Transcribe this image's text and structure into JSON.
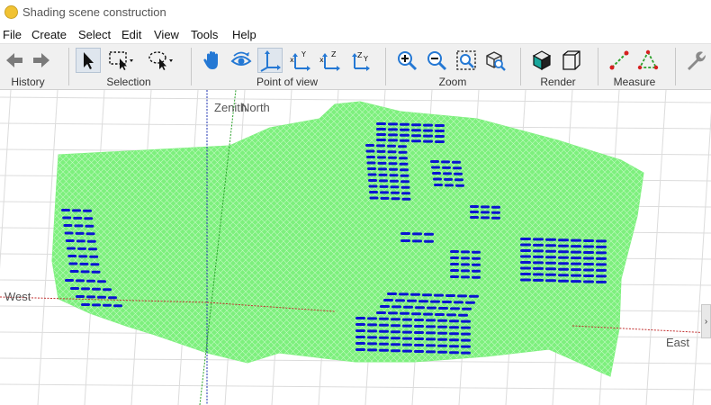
{
  "window": {
    "title": "Shading scene construction"
  },
  "menu": [
    "File",
    "Create",
    "Select",
    "Edit",
    "View",
    "Tools",
    "Help"
  ],
  "toolbar": {
    "groups": [
      "History",
      "Selection",
      "Point of view",
      "Zoom",
      "Render",
      "Measure"
    ]
  },
  "viewport": {
    "labels": {
      "zenith": "Zenith",
      "north": "North",
      "west": "West",
      "east": "East"
    },
    "colors": {
      "terrain": "#7df07d",
      "terrain_mesh": "#ffffff",
      "objects": "#0a14d2"
    }
  },
  "scrollbar": {
    "arrow": "›"
  }
}
